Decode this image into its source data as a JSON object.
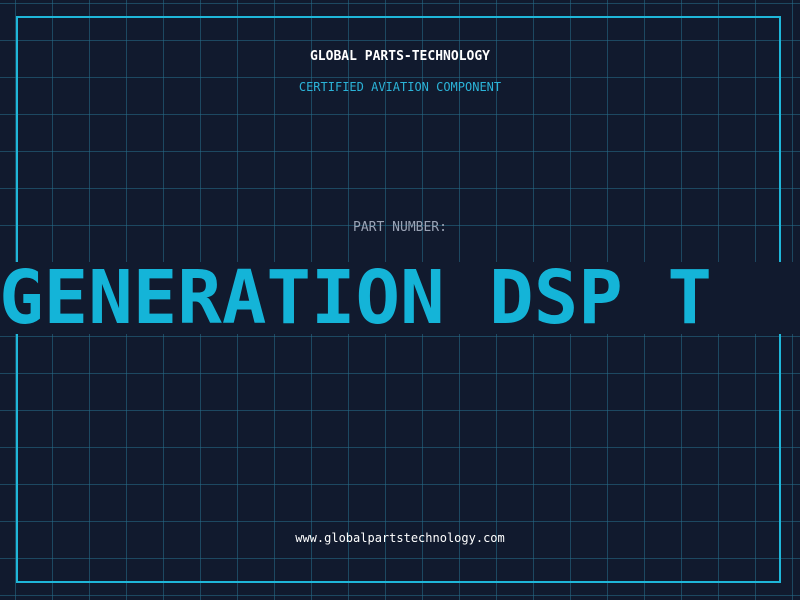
{
  "header": {
    "brand": "GLOBAL PARTS-TECHNOLOGY",
    "tagline": "CERTIFIED AVIATION COMPONENT"
  },
  "part": {
    "label": "PART NUMBER:",
    "value": "H GENERATION DSP T"
  },
  "footer": {
    "url": "www.globalpartstechnology.com"
  },
  "colors": {
    "background": "#111a2e",
    "grid": "#266e8a",
    "accent": "#14b4d8",
    "border": "#1fb6d9",
    "label": "#9aa3b5",
    "text": "#ffffff"
  }
}
